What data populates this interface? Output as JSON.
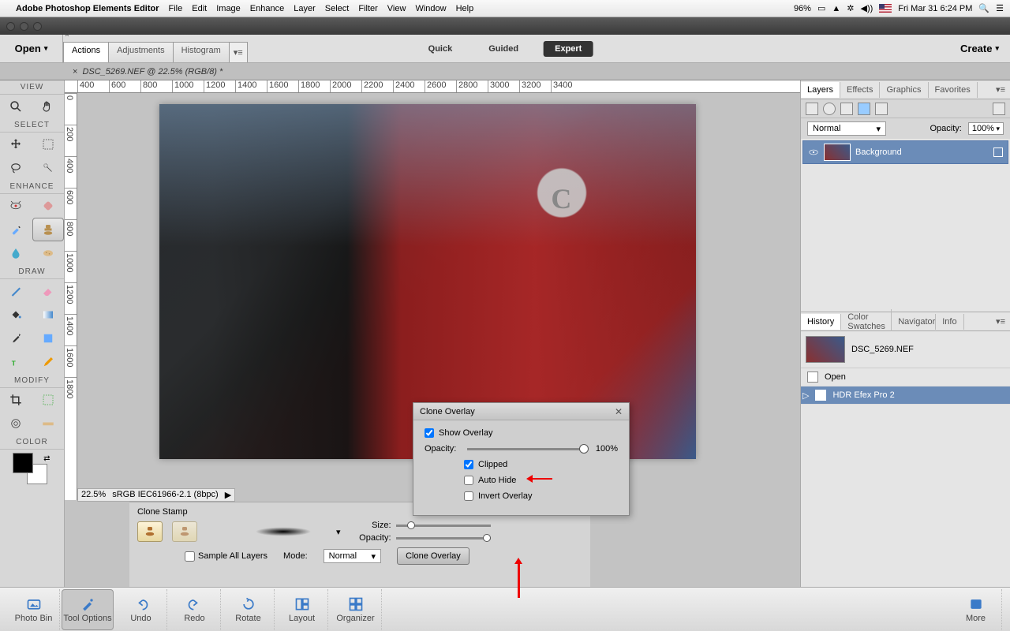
{
  "menubar": {
    "app": "Adobe Photoshop Elements Editor",
    "items": [
      "File",
      "Edit",
      "Image",
      "Enhance",
      "Layer",
      "Select",
      "Filter",
      "View",
      "Window",
      "Help"
    ],
    "battery": "96%",
    "datetime": "Fri Mar 31  6:24 PM"
  },
  "open_label": "Open",
  "tabs": {
    "list": [
      "Actions",
      "Adjustments",
      "Histogram"
    ],
    "active": 0
  },
  "modes": {
    "list": [
      "Quick",
      "Guided",
      "Expert"
    ],
    "active": 2
  },
  "create_label": "Create",
  "doc_tab": "DSC_5269.NEF @ 22.5% (RGB/8) *",
  "toolbox": {
    "groups": [
      "VIEW",
      "SELECT",
      "ENHANCE",
      "DRAW",
      "MODIFY",
      "COLOR"
    ]
  },
  "ruler_h": [
    "400",
    "600",
    "800",
    "1000",
    "1200",
    "1400",
    "1600",
    "1800",
    "2000",
    "2200",
    "2400",
    "2600",
    "2800",
    "3000",
    "3200",
    "3400"
  ],
  "ruler_v": [
    "0",
    "200",
    "400",
    "600",
    "800",
    "1000",
    "1200",
    "1400",
    "1600",
    "1800"
  ],
  "canvas_letter": "C",
  "status": {
    "zoom": "22.5%",
    "profile": "sRGB IEC61966-2.1 (8bpc)"
  },
  "right": {
    "top_tabs": [
      "Layers",
      "Effects",
      "Graphics",
      "Favorites"
    ],
    "blend": "Normal",
    "opacity_label": "Opacity:",
    "opacity_value": "100%",
    "layer_name": "Background",
    "bottom_tabs": [
      "History",
      "Color Swatches",
      "Navigator",
      "Info"
    ],
    "history_file": "DSC_5269.NEF",
    "history_items": [
      "Open",
      "HDR Efex Pro 2"
    ]
  },
  "tool_options": {
    "title": "Clone Stamp",
    "size_label": "Size:",
    "opacity_label": "Opacity:",
    "sample_all": "Sample All Layers",
    "mode_label": "Mode:",
    "mode_value": "Normal",
    "clone_overlay_btn": "Clone Overlay"
  },
  "dialog": {
    "title": "Clone Overlay",
    "show_overlay": "Show Overlay",
    "opacity_label": "Opacity:",
    "opacity_value": "100%",
    "clipped": "Clipped",
    "auto_hide": "Auto Hide",
    "invert": "Invert Overlay"
  },
  "shelf": [
    "Photo Bin",
    "Tool Options",
    "Undo",
    "Redo",
    "Rotate",
    "Layout",
    "Organizer"
  ],
  "shelf_more": "More"
}
